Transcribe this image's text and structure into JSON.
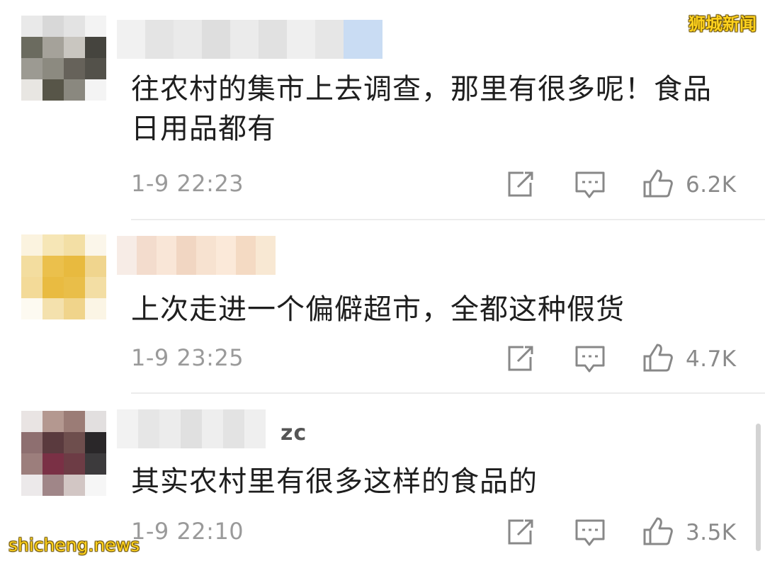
{
  "watermark": "狮城新闻",
  "site_mark": "shicheng.news",
  "comments": [
    {
      "text": "往农村的集市上去调查，那里有很多呢！食品 日用品都有",
      "time": "1-9 22:23",
      "likes": "6.2K",
      "username_suffix": ""
    },
    {
      "text": "上次走进一个偏僻超市，全都这种假货",
      "time": "1-9 23:25",
      "likes": "4.7K",
      "username_suffix": ""
    },
    {
      "text": "其实农村里有很多这样的食品的",
      "time": "1-9 22:10",
      "likes": "3.5K",
      "username_suffix": "zc"
    }
  ],
  "icons": {
    "share": "share-icon",
    "reply": "comment-icon",
    "like": "thumbs-up-icon"
  },
  "colors": {
    "text": "#1e1e1e",
    "meta": "#9a9a9a",
    "watermark": "#ffd21f"
  }
}
